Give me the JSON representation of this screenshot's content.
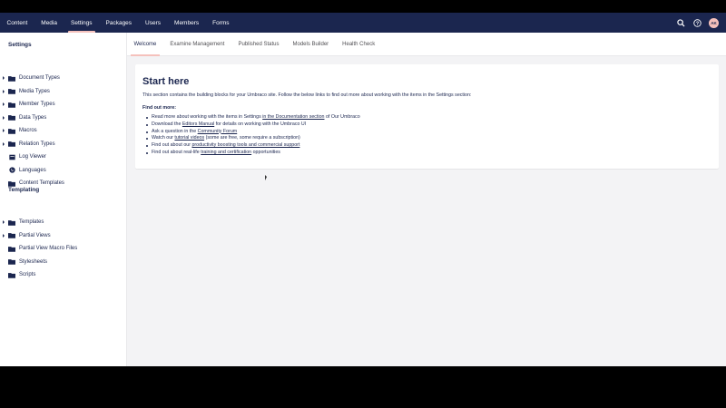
{
  "nav": {
    "items": [
      "Content",
      "Media",
      "Settings",
      "Packages",
      "Users",
      "Members",
      "Forms"
    ],
    "active": "Settings",
    "user_initials": "AK"
  },
  "sidebar": {
    "settings_title": "Settings",
    "settings_items": [
      {
        "label": "Document Types",
        "icon": "folder-icon",
        "expandable": true
      },
      {
        "label": "Media Types",
        "icon": "folder-icon",
        "expandable": true
      },
      {
        "label": "Member Types",
        "icon": "folder-icon",
        "expandable": true
      },
      {
        "label": "Data Types",
        "icon": "folder-icon",
        "expandable": true
      },
      {
        "label": "Macros",
        "icon": "folder-icon",
        "expandable": true
      },
      {
        "label": "Relation Types",
        "icon": "folder-icon",
        "expandable": true
      },
      {
        "label": "Log Viewer",
        "icon": "box-icon",
        "expandable": false
      },
      {
        "label": "Languages",
        "icon": "globe-icon",
        "expandable": false
      },
      {
        "label": "Content Templates",
        "icon": "folder-icon",
        "expandable": false
      }
    ],
    "templating_title": "Templating",
    "templating_items": [
      {
        "label": "Templates",
        "icon": "folder-icon",
        "expandable": true
      },
      {
        "label": "Partial Views",
        "icon": "folder-icon",
        "expandable": true
      },
      {
        "label": "Partial View Macro Files",
        "icon": "folder-icon",
        "expandable": false
      },
      {
        "label": "Stylesheets",
        "icon": "folder-icon",
        "expandable": false
      },
      {
        "label": "Scripts",
        "icon": "folder-icon",
        "expandable": false
      }
    ]
  },
  "tabs": {
    "items": [
      "Welcome",
      "Examine Management",
      "Published Status",
      "Models Builder",
      "Health Check"
    ],
    "active": "Welcome"
  },
  "welcome": {
    "title": "Start here",
    "intro": "This section contains the building blocks for your Umbraco site. Follow the below links to find out more about working with the items in the Settings section:",
    "find_out_more": "Find out more:",
    "links": [
      {
        "pre": "Read more about working with the items in Settings ",
        "link": "in the Documentation section",
        "post": " of Our Umbraco"
      },
      {
        "pre": "Download the ",
        "link": "Editors Manual",
        "post": " for details on working with the Umbraco UI"
      },
      {
        "pre": "Ask a question in the ",
        "link": "Community Forum",
        "post": ""
      },
      {
        "pre": "Watch our ",
        "link": "tutorial videos",
        "post": " (some are free, some require a subscription)"
      },
      {
        "pre": "Find out about our ",
        "link": "productivity boosting tools and commercial support",
        "post": ""
      },
      {
        "pre": "Find out about real-life ",
        "link": "training and certification",
        "post": " opportunities"
      }
    ]
  },
  "colors": {
    "nav_bg": "#1b264f",
    "accent": "#f5c1bc",
    "text": "#1b264f",
    "panel_bg": "#f3f3f5"
  }
}
